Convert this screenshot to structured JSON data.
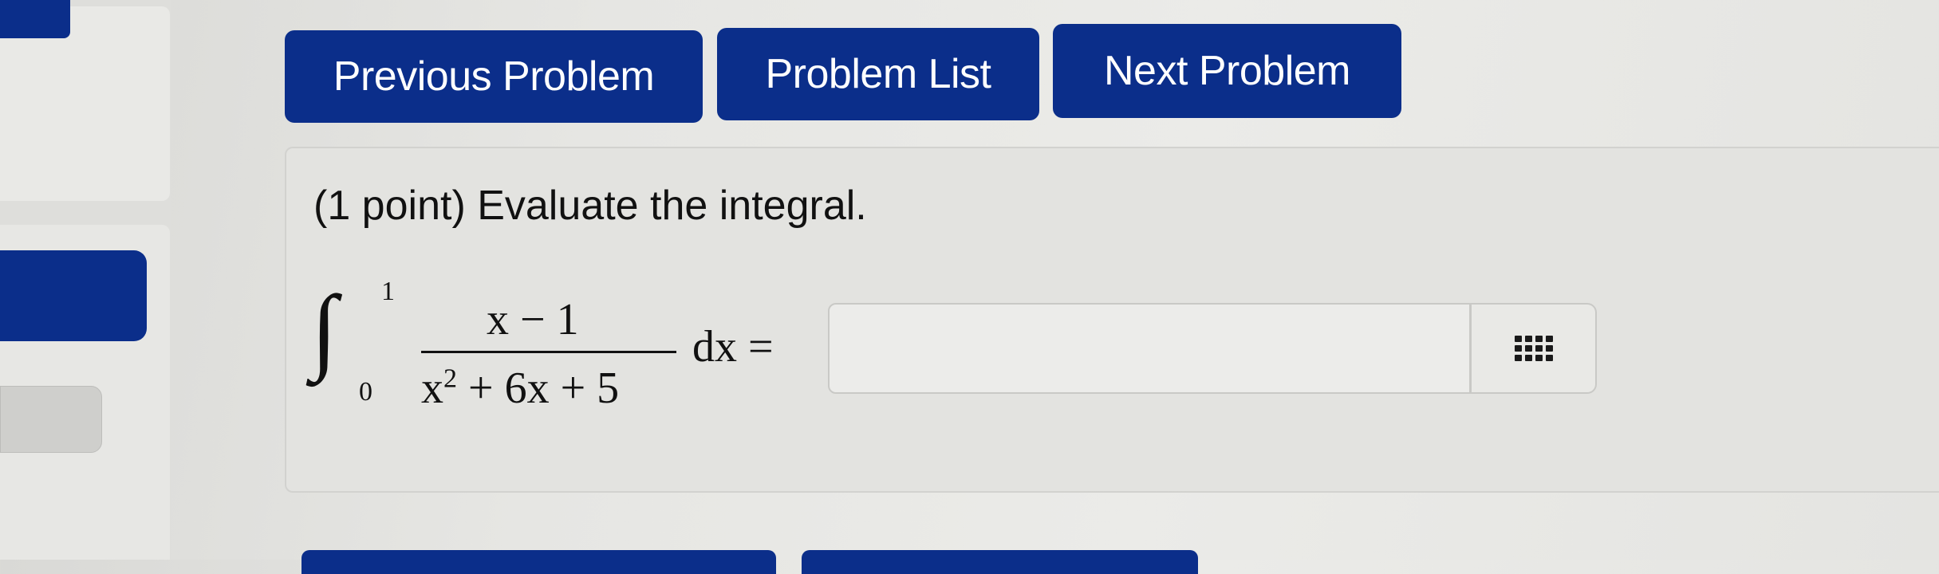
{
  "colors": {
    "primary_button": "#0b2e8a",
    "button_text": "#ffffff",
    "problem_background": "#e3e3e0",
    "input_background": "#ececea"
  },
  "nav": {
    "previous_label": "Previous Problem",
    "list_label": "Problem List",
    "next_label": "Next Problem"
  },
  "problem": {
    "header": "(1 point) Evaluate the integral.",
    "integral": {
      "sign": "∫",
      "upper_limit": "1",
      "lower_limit": "0",
      "numerator": "x − 1",
      "denominator_base": "x",
      "denominator_exp": "2",
      "denominator_rest": " + 6x + 5",
      "differential": "dx ="
    },
    "answer": {
      "value": "",
      "placeholder": ""
    },
    "keypad_icon": "keypad-grid-icon"
  }
}
